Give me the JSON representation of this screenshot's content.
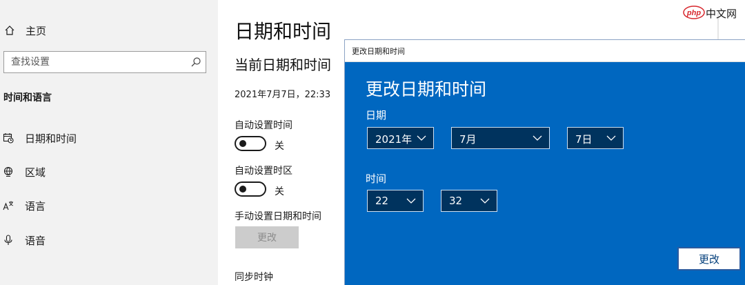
{
  "nav": {
    "home_label": "主页",
    "search_placeholder": "查找设置",
    "section_title": "时间和语言",
    "items": [
      {
        "label": "日期和时间",
        "icon": "calendar-clock-icon"
      },
      {
        "label": "区域",
        "icon": "globe-icon"
      },
      {
        "label": "语言",
        "icon": "language-icon"
      },
      {
        "label": "语音",
        "icon": "microphone-icon"
      }
    ]
  },
  "main": {
    "title": "日期和时间",
    "subtitle": "当前日期和时间",
    "current_datetime": "2021年7月7日，22:33",
    "auto_time_label": "自动设置时间",
    "auto_time_state": "关",
    "auto_zone_label": "自动设置时区",
    "auto_zone_state": "关",
    "manual_label": "手动设置日期和时间",
    "change_button": "更改",
    "sync_label": "同步时钟"
  },
  "dialog": {
    "window_title": "更改日期和时间",
    "heading": "更改日期和时间",
    "date_label": "日期",
    "year": "2021年",
    "month": "7月",
    "day": "7日",
    "time_label": "时间",
    "hour": "22",
    "minute": "32",
    "change_button": "更改"
  },
  "watermark": {
    "text": "中文网"
  },
  "colors": {
    "accent": "#0067c0",
    "combo_fill": "#00335e",
    "nav_bg": "#f2f2f2"
  }
}
